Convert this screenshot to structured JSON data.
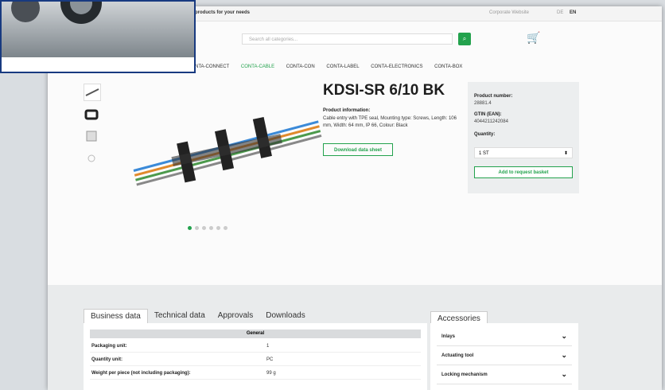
{
  "topbar": {
    "tagline": "products for your needs",
    "website_link": "Corporate Website",
    "lang_de": "DE",
    "lang_en": "EN"
  },
  "search": {
    "placeholder": "Search all categories..."
  },
  "nav": {
    "items": [
      "CONTA-CONNECT",
      "CONTA-CABLE",
      "CONTA-CON",
      "CONTA-LABEL",
      "CONTA-ELECTRONICS",
      "CONTA-BOX"
    ],
    "active": "CONTA-CABLE"
  },
  "product": {
    "title": "KDSI-SR 6/10 BK",
    "info_heading": "Product information:",
    "info_text": "Cable entry with TPE seal, Mounting type: Screws, Length: 106 mm, Width: 64 mm, IP 66, Colour: Black",
    "download_label": "Download data sheet"
  },
  "panel": {
    "product_number_label": "Product number:",
    "product_number": "28881.4",
    "gtin_label": "GTIN (EAN):",
    "gtin": "4044211242084",
    "quantity_label": "Quantity:",
    "quantity_value": "1 ST",
    "basket_label": "Add to request basket"
  },
  "tabs": [
    "Business data",
    "Technical data",
    "Approvals",
    "Downloads"
  ],
  "table": {
    "header": "General",
    "rows": [
      {
        "k": "Packaging unit:",
        "v": "1"
      },
      {
        "k": "Quantity unit:",
        "v": "PC"
      },
      {
        "k": "Weight per piece (not including packaging):",
        "v": "99 g"
      }
    ]
  },
  "accessories": {
    "title": "Accessories",
    "items": [
      "Inlays",
      "Actuating tool",
      "Locking mechanism"
    ]
  }
}
